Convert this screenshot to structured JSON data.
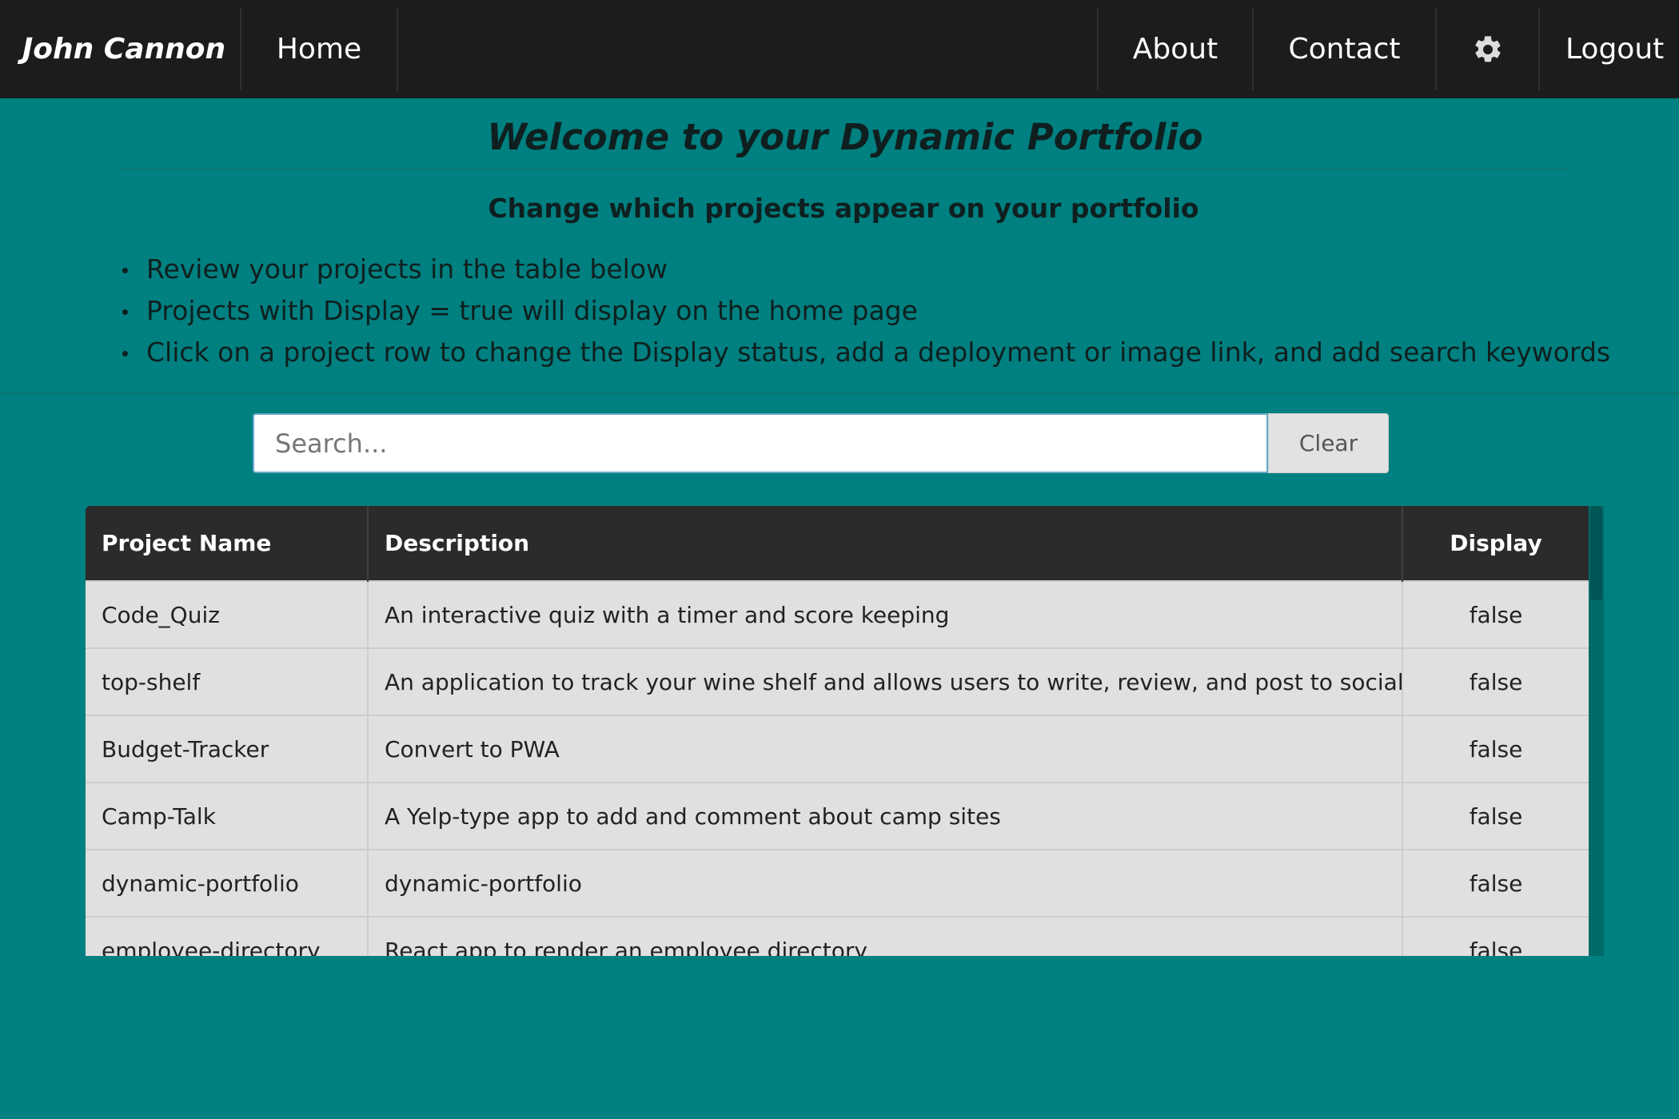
{
  "navbar": {
    "brand": "John Cannon",
    "home": "Home",
    "about": "About",
    "contact": "Contact",
    "settings_icon": "gear-icon",
    "logout": "Logout"
  },
  "header": {
    "title": "Welcome to your Dynamic Portfolio",
    "subtitle": "Change which projects appear on your portfolio",
    "bullets": [
      "Review your projects in the table below",
      "Projects with Display = true will display on the home page",
      "Click on a project row to change the Display status, add a deployment or image link, and add search keywords"
    ]
  },
  "search": {
    "placeholder": "Search...",
    "value": "",
    "clear_label": "Clear"
  },
  "table": {
    "columns": [
      "Project Name",
      "Description",
      "Display"
    ],
    "rows": [
      {
        "name": "Code_Quiz",
        "description": "An interactive quiz with a timer and score keeping",
        "display": "false"
      },
      {
        "name": "top-shelf",
        "description": "An application to track your wine shelf and allows users to write, review, and post to social media.",
        "display": "false"
      },
      {
        "name": "Budget-Tracker",
        "description": "Convert to PWA",
        "display": "false"
      },
      {
        "name": "Camp-Talk",
        "description": "A Yelp-type app to add and comment about camp sites",
        "display": "false"
      },
      {
        "name": "dynamic-portfolio",
        "description": "dynamic-portfolio",
        "display": "false"
      },
      {
        "name": "employee-directory",
        "description": "React app to render an employee directory",
        "display": "false"
      }
    ]
  },
  "colors": {
    "background": "#008080",
    "navbar": "#1b1c1e",
    "table_header": "#2b2b2c",
    "table_row": "#e0e0e0"
  }
}
